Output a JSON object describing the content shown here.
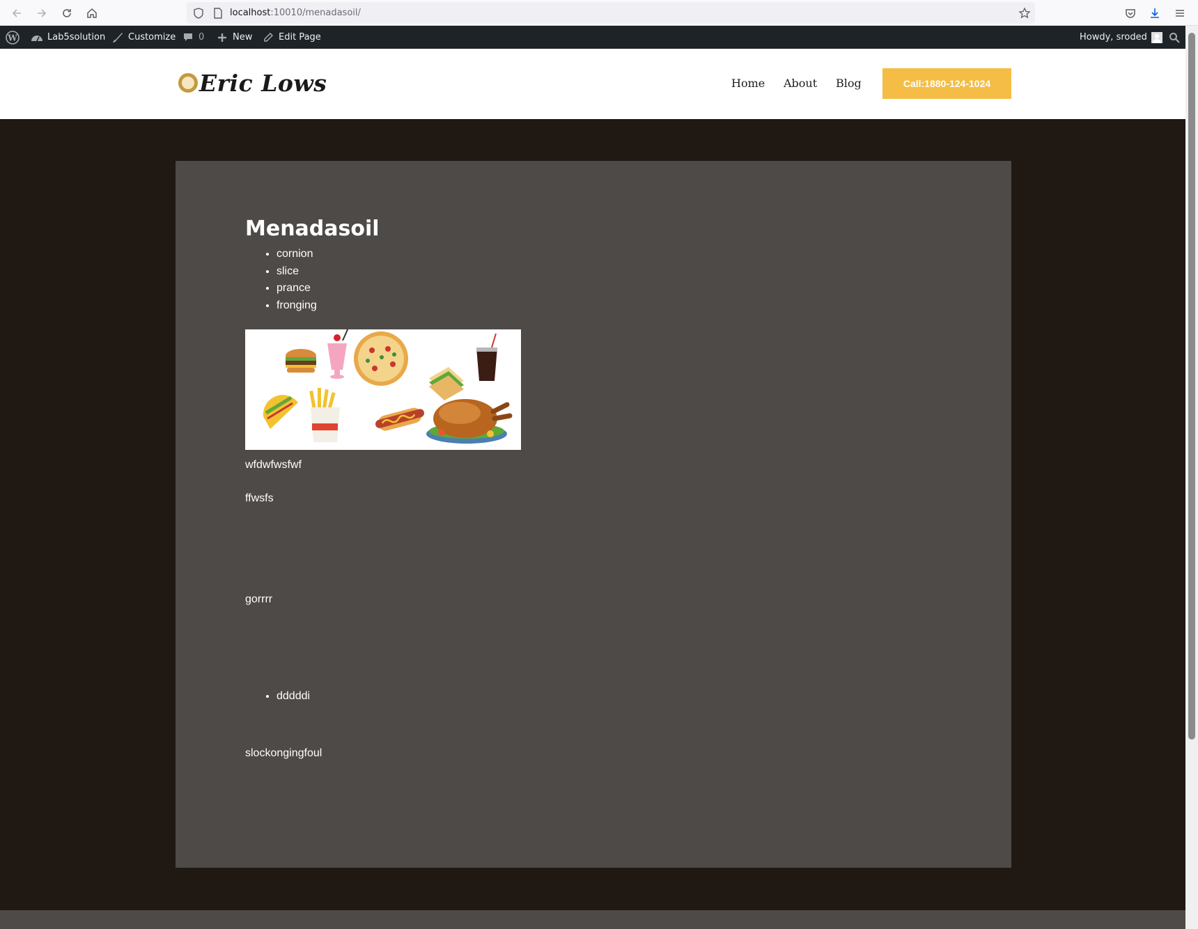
{
  "browser": {
    "url_host": "localhost",
    "url_path": ":10010/menadasoil/"
  },
  "admin_bar": {
    "site_name": "Lab5solution",
    "customize": "Customize",
    "comments_count": "0",
    "new_label": "New",
    "edit_page": "Edit Page",
    "howdy": "Howdy, sroded"
  },
  "header": {
    "logo_text": "Eric Lows",
    "nav": [
      "Home",
      "About",
      "Blog"
    ],
    "call_button": "Call:1880-124-1024"
  },
  "page": {
    "title": "Menadasoil",
    "list1": [
      "cornion",
      "slice",
      "prance",
      "fronging"
    ],
    "para1": "wfdwfwsfwf",
    "para2": "ffwsfs",
    "para3": "gorrrr",
    "list2": [
      "dddddi"
    ],
    "para4": "slockongingfoul"
  },
  "colors": {
    "accent": "#f5bd45",
    "page_bg": "#1f1813",
    "card_bg": "#4d4a47",
    "admin_bar": "#1d2327"
  }
}
